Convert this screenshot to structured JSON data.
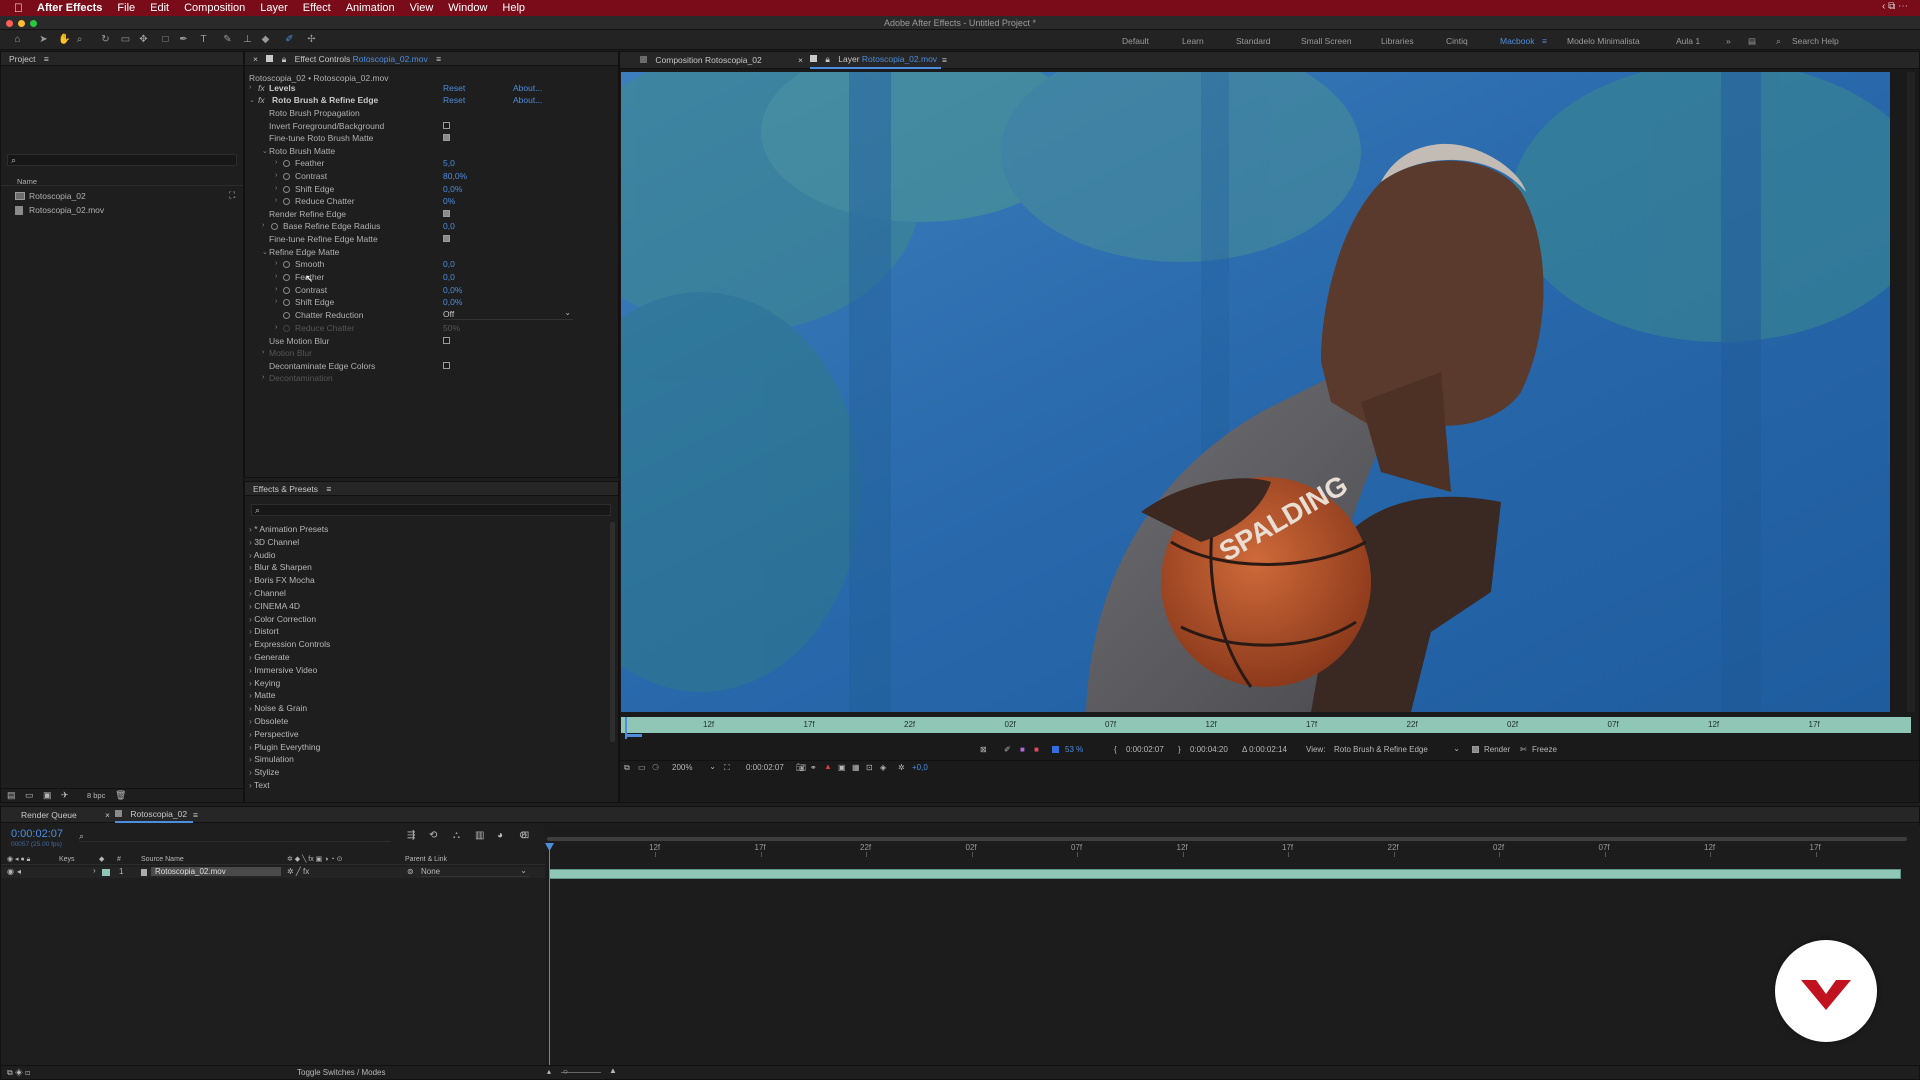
{
  "menubar": {
    "apple": "",
    "app": "After Effects",
    "items": [
      "File",
      "Edit",
      "Composition",
      "Layer",
      "Effect",
      "Animation",
      "View",
      "Window",
      "Help"
    ]
  },
  "window_title": "Adobe After Effects - Untitled Project *",
  "workspaces": [
    "Default",
    "Learn",
    "Standard",
    "Small Screen",
    "Libraries",
    "Cintiq",
    "Macbook",
    "Modelo Minimalista",
    "Aula 1"
  ],
  "active_workspace": "Macbook",
  "search_help": "Search Help",
  "project": {
    "title": "Project",
    "col_name": "Name",
    "items": [
      "Rotoscopia_02",
      "Rotoscopia_02.mov"
    ],
    "bpc": "8 bpc"
  },
  "effect_controls": {
    "title": "Effect Controls",
    "layer": "Rotoscopia_02.mov",
    "path": "Rotoscopia_02 • Rotoscopia_02.mov",
    "reset": "Reset",
    "about": "About...",
    "fx_levels": "Levels",
    "fx_roto": "Roto Brush & Refine Edge",
    "rows": [
      {
        "label": "Roto Brush Propagation",
        "value": ""
      },
      {
        "label": "Invert Foreground/Background",
        "value": ""
      },
      {
        "label": "Fine-tune Roto Brush Matte",
        "value": ""
      },
      {
        "label": "Roto Brush Matte",
        "value": ""
      },
      {
        "label": "Feather",
        "value": "5,0"
      },
      {
        "label": "Contrast",
        "value": "80,0%"
      },
      {
        "label": "Shift Edge",
        "value": "0,0%"
      },
      {
        "label": "Reduce Chatter",
        "value": "0%"
      },
      {
        "label": "Render Refine Edge",
        "value": ""
      },
      {
        "label": "Base Refine Edge Radius",
        "value": "0,0"
      },
      {
        "label": "Fine-tune Refine Edge Matte",
        "value": ""
      },
      {
        "label": "Refine Edge Matte",
        "value": ""
      },
      {
        "label": "Smooth",
        "value": "0,0"
      },
      {
        "label": "Feather",
        "value": "0,0"
      },
      {
        "label": "Contrast",
        "value": "0,0%"
      },
      {
        "label": "Shift Edge",
        "value": "0,0%"
      },
      {
        "label": "Chatter Reduction",
        "value": "Off"
      },
      {
        "label": "Reduce Chatter",
        "value": "50%"
      },
      {
        "label": "Use Motion Blur",
        "value": ""
      },
      {
        "label": "Motion Blur",
        "value": ""
      },
      {
        "label": "Decontaminate Edge Colors",
        "value": ""
      },
      {
        "label": "Decontamination",
        "value": ""
      }
    ]
  },
  "effects_presets": {
    "title": "Effects & Presets",
    "items": [
      "* Animation Presets",
      "3D Channel",
      "Audio",
      "Blur & Sharpen",
      "Boris FX Mocha",
      "Channel",
      "CINEMA 4D",
      "Color Correction",
      "Distort",
      "Expression Controls",
      "Generate",
      "Immersive Video",
      "Keying",
      "Matte",
      "Noise & Grain",
      "Obsolete",
      "Perspective",
      "Plugin Everything",
      "Simulation",
      "Stylize",
      "Text"
    ]
  },
  "viewer": {
    "tab_comp": "Composition",
    "tab_comp_name": "Rotoscopia_02",
    "tab_layer": "Layer",
    "tab_layer_name": "Rotoscopia_02.mov",
    "ruler": [
      "12f",
      "17f",
      "22f",
      "02f",
      "07f",
      "12f",
      "17f",
      "22f",
      "02f",
      "07f",
      "12f",
      "17f"
    ],
    "zoom_pct": "53 %",
    "in_time": "0:00:02:07",
    "out_time": "0:00:04:20",
    "duration": "Δ 0:00:02:14",
    "view_label": "View:",
    "view_value": "Roto Brush & Refine Edge",
    "render": "Render",
    "freeze": "Freeze",
    "magnification": "200%",
    "current_time": "0:00:02:07",
    "exposure": "+0,0",
    "ball_text": "SPALDING"
  },
  "timeline": {
    "render_queue": "Render Queue",
    "comp_tab": "Rotoscopia_02",
    "timecode": "0:00:02:07",
    "frame_info": "00057 (25.00 fps)",
    "cols": {
      "keys": "Keys",
      "num": "#",
      "source": "Source Name",
      "parent": "Parent & Link"
    },
    "layer": {
      "num": "1",
      "name": "Rotoscopia_02.mov",
      "parent": "None"
    },
    "ruler": [
      "12f",
      "17f",
      "22f",
      "02f",
      "07f",
      "12f",
      "17f",
      "22f",
      "02f",
      "07f",
      "12f",
      "17f"
    ],
    "toggle": "Toggle Switches / Modes"
  },
  "colors": {
    "menubar": "#7a0c19",
    "accent": "#4c8dde",
    "sky": "#2e6fb0",
    "ball": "#b5552a",
    "logo": "#c1121f"
  }
}
